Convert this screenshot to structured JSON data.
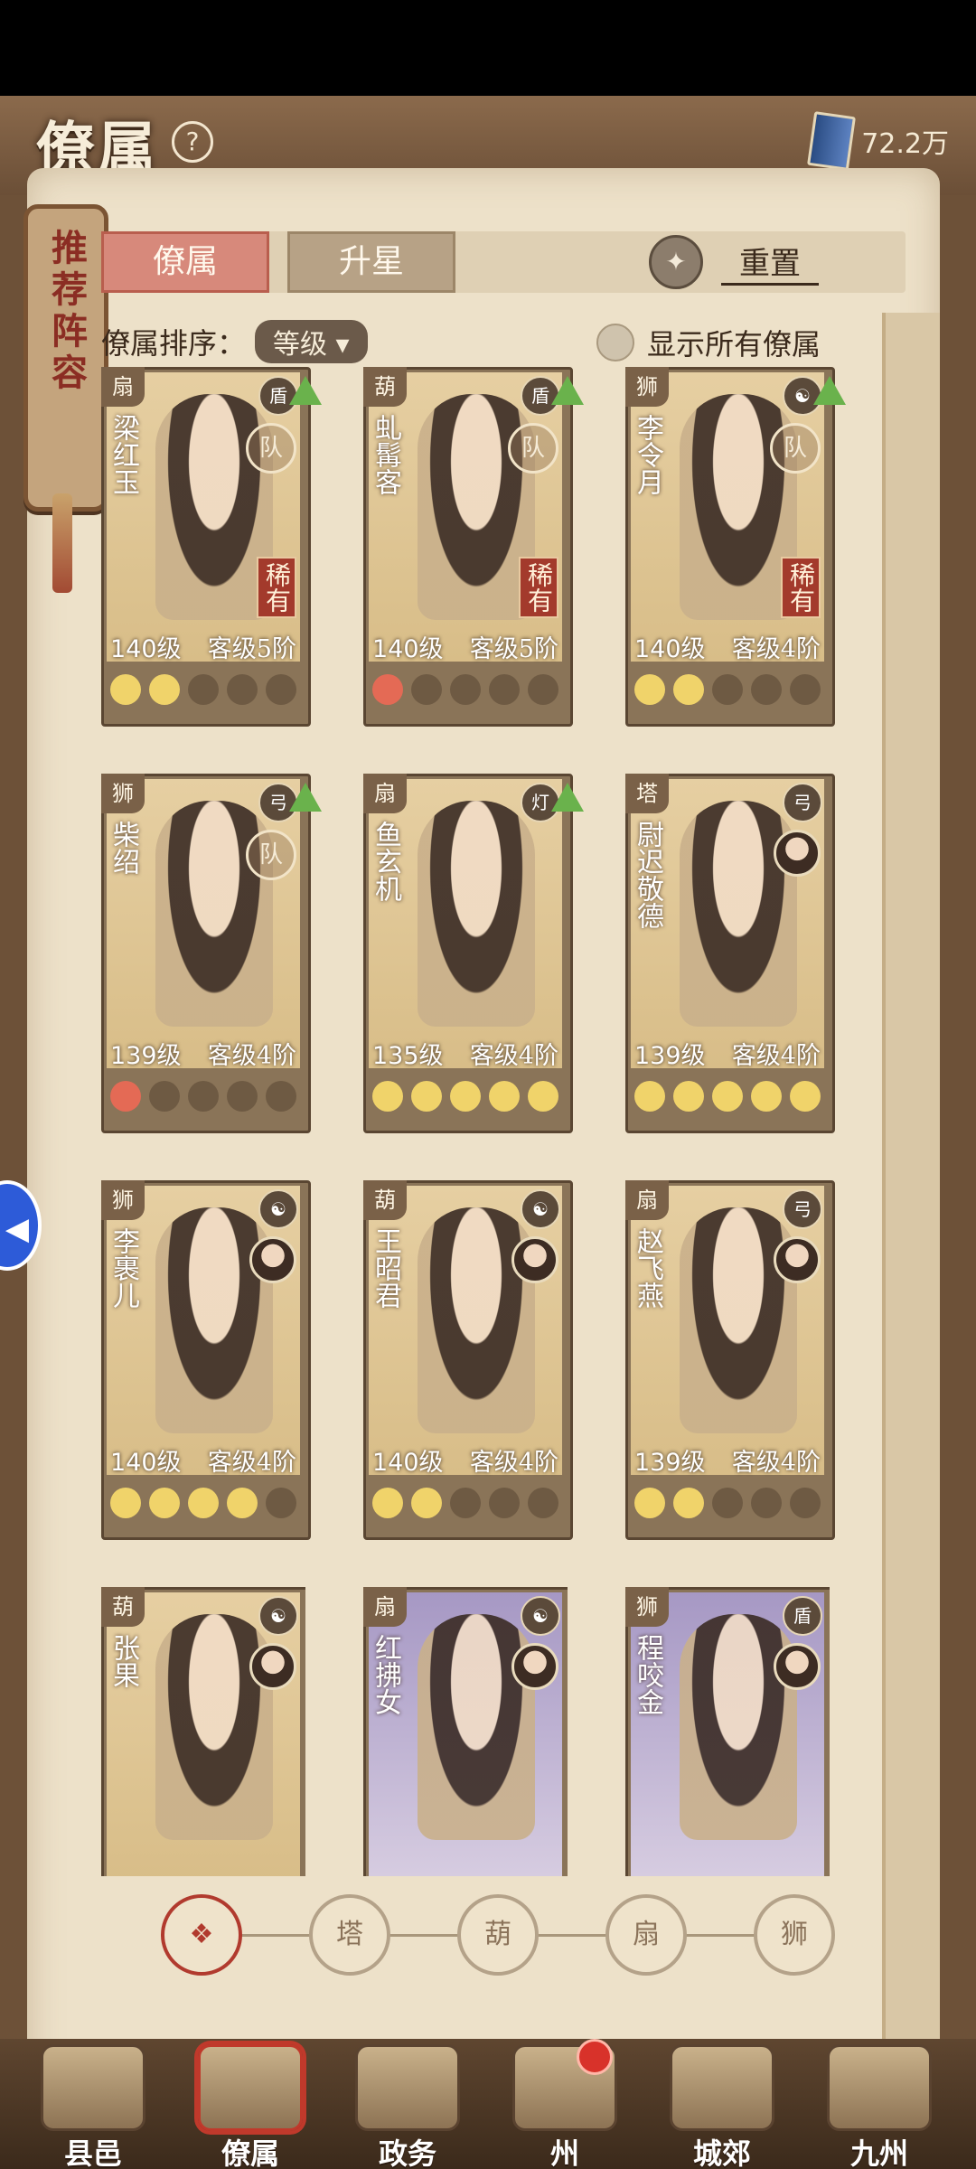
{
  "header": {
    "title": "僚属",
    "help": "?",
    "currency": "72.2万"
  },
  "side_banner": "推荐阵容",
  "tabs": [
    {
      "label": "僚属",
      "active": true
    },
    {
      "label": "升星",
      "active": false
    }
  ],
  "reset_label": "重置",
  "sort": {
    "label": "僚属排序：",
    "value": "等级"
  },
  "show_all_label": "显示所有僚属",
  "cards": [
    {
      "name": "梁红玉",
      "level": "140级",
      "grade": "客级5阶",
      "rare": "稀有",
      "team": "队",
      "upgrade": true,
      "stars": [
        "on",
        "on",
        "off",
        "off",
        "off"
      ],
      "bg": "gold",
      "class_icon": "扇",
      "skill_icon": "盾"
    },
    {
      "name": "虬髯客",
      "level": "140级",
      "grade": "客级5阶",
      "rare": "稀有",
      "team": "队",
      "upgrade": true,
      "stars": [
        "red",
        "off",
        "off",
        "off",
        "off"
      ],
      "bg": "gold",
      "class_icon": "葫",
      "skill_icon": "盾"
    },
    {
      "name": "李令月",
      "level": "140级",
      "grade": "客级4阶",
      "rare": "稀有",
      "team": "队",
      "upgrade": true,
      "stars": [
        "on",
        "on",
        "off",
        "off",
        "off"
      ],
      "bg": "gold",
      "class_icon": "狮",
      "skill_icon": "☯"
    },
    {
      "name": "柴绍",
      "level": "139级",
      "grade": "客级4阶",
      "rare": "",
      "team": "队",
      "upgrade": true,
      "stars": [
        "red",
        "off",
        "off",
        "off",
        "off"
      ],
      "bg": "gold",
      "class_icon": "狮",
      "skill_icon": "弓"
    },
    {
      "name": "鱼玄机",
      "level": "135级",
      "grade": "客级4阶",
      "rare": "",
      "team": "",
      "upgrade": true,
      "stars": [
        "on",
        "on",
        "on",
        "on",
        "on"
      ],
      "bg": "gold",
      "class_icon": "扇",
      "skill_icon": "灯"
    },
    {
      "name": "尉迟敬德",
      "level": "139级",
      "grade": "客级4阶",
      "rare": "",
      "team": "",
      "avatar": true,
      "upgrade": false,
      "stars": [
        "on",
        "on",
        "on",
        "on",
        "on"
      ],
      "bg": "gold",
      "class_icon": "塔",
      "skill_icon": "弓"
    },
    {
      "name": "李裹儿",
      "level": "140级",
      "grade": "客级4阶",
      "rare": "",
      "team": "",
      "avatar": true,
      "upgrade": false,
      "stars": [
        "on",
        "on",
        "on",
        "on",
        "off"
      ],
      "bg": "gold",
      "class_icon": "狮",
      "skill_icon": "☯"
    },
    {
      "name": "王昭君",
      "level": "140级",
      "grade": "客级4阶",
      "rare": "",
      "team": "",
      "avatar": true,
      "upgrade": false,
      "stars": [
        "on",
        "on",
        "off",
        "off",
        "off"
      ],
      "bg": "gold",
      "class_icon": "葫",
      "skill_icon": "☯"
    },
    {
      "name": "赵飞燕",
      "level": "139级",
      "grade": "客级4阶",
      "rare": "",
      "team": "",
      "avatar": true,
      "upgrade": false,
      "stars": [
        "on",
        "on",
        "off",
        "off",
        "off"
      ],
      "bg": "gold",
      "class_icon": "扇",
      "skill_icon": "弓"
    },
    {
      "name": "张果",
      "level": "",
      "grade": "",
      "rare": "",
      "team": "",
      "avatar": true,
      "upgrade": false,
      "stars": [],
      "bg": "gold",
      "class_icon": "葫",
      "skill_icon": "☯"
    },
    {
      "name": "红拂女",
      "level": "",
      "grade": "",
      "rare": "",
      "team": "",
      "avatar": true,
      "upgrade": false,
      "stars": [],
      "bg": "purple",
      "class_icon": "扇",
      "skill_icon": "☯"
    },
    {
      "name": "程咬金",
      "level": "",
      "grade": "",
      "rare": "",
      "team": "",
      "avatar": true,
      "upgrade": false,
      "stars": [],
      "bg": "purple",
      "class_icon": "狮",
      "skill_icon": "盾"
    }
  ],
  "filters": [
    {
      "icon": "❖",
      "active": true
    },
    {
      "icon": "塔",
      "active": false
    },
    {
      "icon": "葫",
      "active": false
    },
    {
      "icon": "扇",
      "active": false
    },
    {
      "icon": "狮",
      "active": false
    }
  ],
  "nav": [
    {
      "label": "县邑",
      "active": false,
      "badge": false
    },
    {
      "label": "僚属",
      "active": true,
      "badge": false
    },
    {
      "label": "政务",
      "active": false,
      "badge": false
    },
    {
      "label": "州",
      "active": false,
      "badge": true
    },
    {
      "label": "城郊",
      "active": false,
      "badge": false
    },
    {
      "label": "九州",
      "active": false,
      "badge": false
    }
  ]
}
